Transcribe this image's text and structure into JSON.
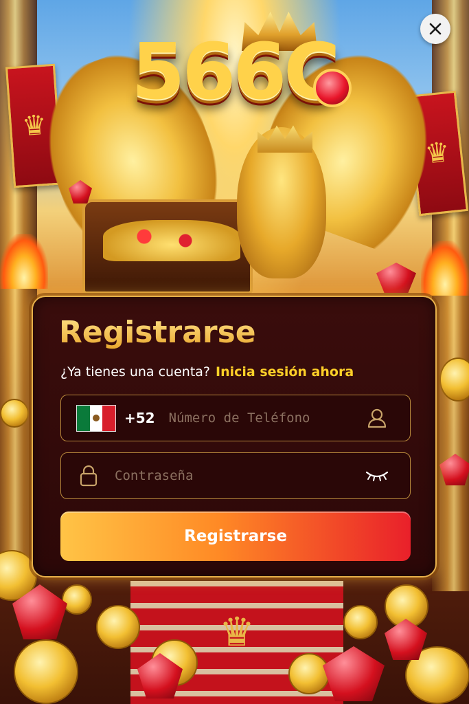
{
  "app": {
    "logo_text": "566C"
  },
  "close_button": {
    "icon": "close-icon"
  },
  "register": {
    "title": "Registrarse",
    "login_prompt": "¿Ya tienes una cuenta?",
    "login_link": "Inicia sesión ahora",
    "phone": {
      "country_flag": "mexico-flag-icon",
      "dial_code": "+52",
      "placeholder": "Número de Teléfono",
      "value": "",
      "icon": "user-icon"
    },
    "password": {
      "placeholder": "Contraseña",
      "value": "",
      "lock_icon": "lock-icon",
      "toggle_icon": "eye-closed-icon"
    },
    "submit_label": "Registrarse"
  },
  "colors": {
    "accent_gold": "#f7c95a",
    "link_yellow": "#ffd028",
    "card_bg": "#3a0d0c",
    "button_gradient": [
      "#ffc446",
      "#ff8a25",
      "#e9202a"
    ]
  }
}
